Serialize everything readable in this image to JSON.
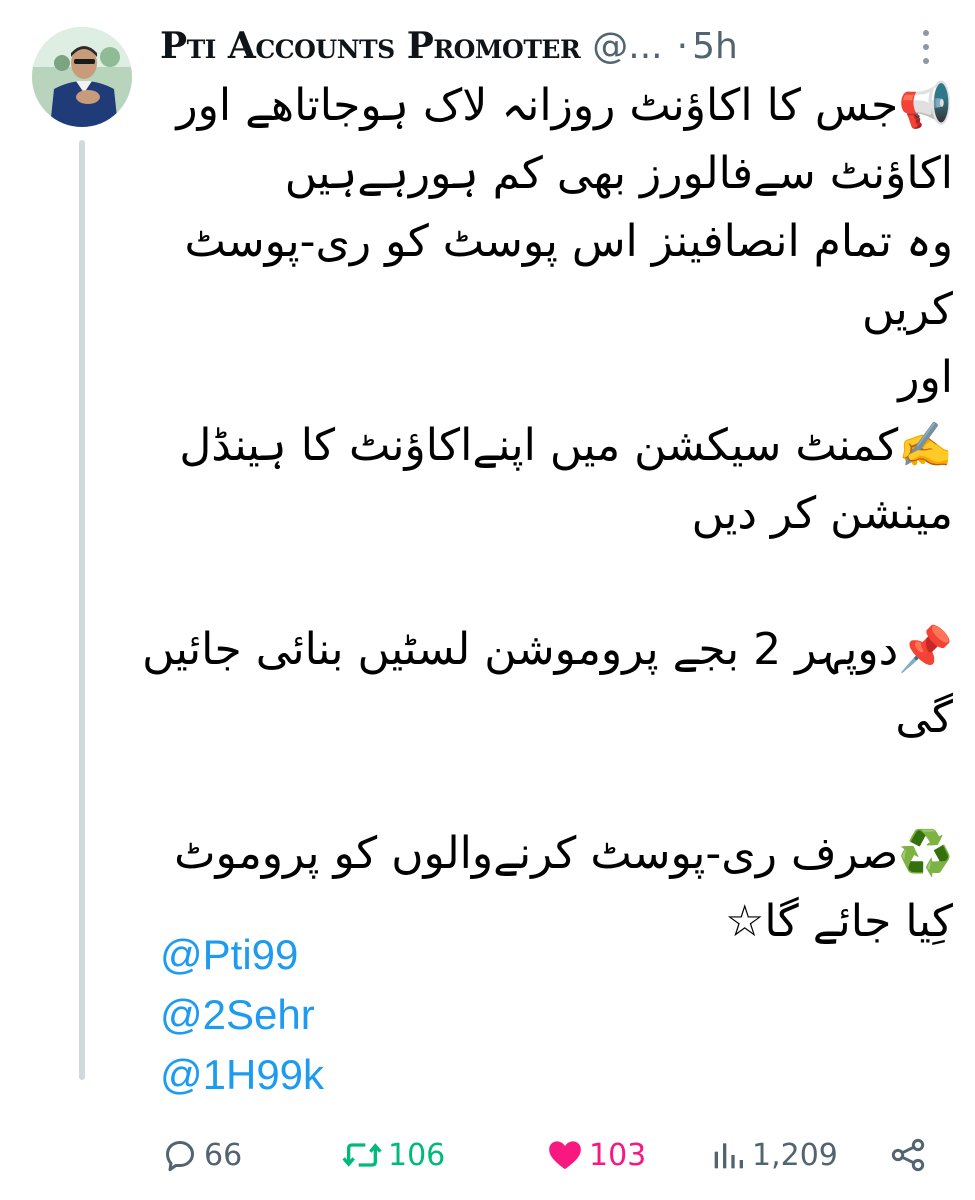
{
  "tweet": {
    "author_name": "Pti Accounts Promoter",
    "handle": "@...",
    "separator": "·",
    "time": "5h",
    "body_lines": [
      "📢جس کا اکاؤنٹ روزانہ لاک ہوجاتاھے اور",
      "اکاؤنٹ سےفالورز بھی کم ہورہےہیں",
      "وہ تمام انصافینز اس پوسٹ کو ری-پوسٹ",
      "کریں",
      "اور",
      "✍️کمنٹ سیکشن میں اپنےاکاؤنٹ کا ہینڈل",
      "مینشن کر دیں",
      "",
      "📌دوپہر 2 بجے پروموشن لسٹیں بنائی جائیں",
      "گی",
      "",
      "♻️صرف ری-پوسٹ کرنےوالوں کو پروموٹ",
      "کِیا جائے گا☆"
    ],
    "mentions": [
      "@Pti99",
      "@2Sehr",
      "@1H99k"
    ]
  },
  "actions": {
    "replies": "66",
    "reposts": "106",
    "likes": "103",
    "views": "1,209"
  },
  "icons": {
    "reply": "reply-icon",
    "repost": "repost-icon",
    "like": "heart-icon",
    "views": "views-icon",
    "share": "share-icon",
    "more": "more-vertical-icon"
  },
  "colors": {
    "mention": "#1d9bf0",
    "repost_active": "#00ba7c",
    "like_active": "#f91880",
    "muted": "#536471"
  }
}
